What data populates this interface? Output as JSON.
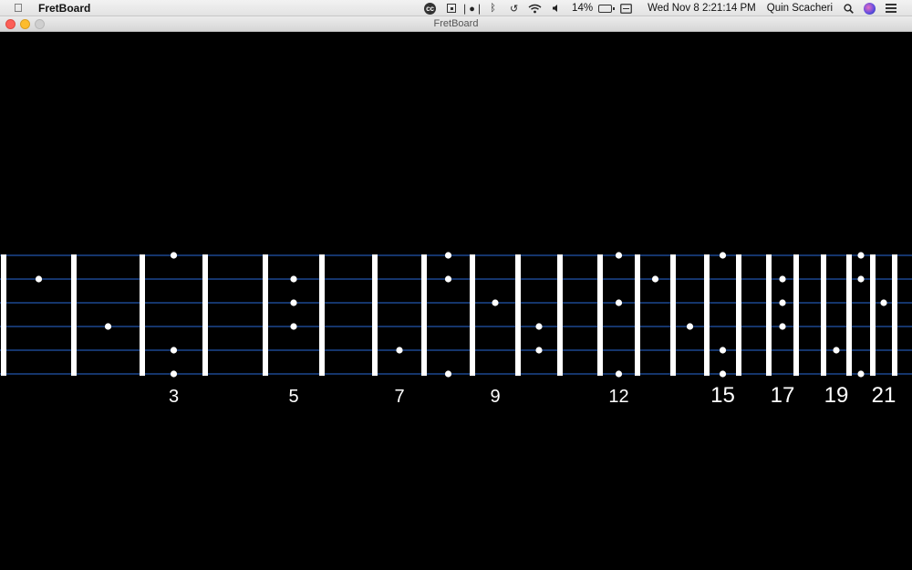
{
  "menubar": {
    "apple_icon": "apple-icon",
    "app_name": "FretBoard",
    "status_icons": [
      "creative-cloud-icon",
      "grid-icon",
      "audio-input-icon",
      "bluetooth-icon",
      "time-machine-icon",
      "wifi-icon",
      "volume-icon"
    ],
    "battery_percent": "14%",
    "datetime": "Wed Nov 8  2:21:14 PM",
    "user": "Quin Scacheri"
  },
  "window": {
    "title": "FretBoard",
    "traffic_lights": {
      "close": "#fc5f57",
      "minimize": "#fdbc2e",
      "zoom": "#cfcfcf"
    }
  },
  "fretboard": {
    "background": "#000000",
    "string_color": "#2a6ad8",
    "fret_color": "#ffffff",
    "string_count": 6,
    "fret_count": 21,
    "fret_labels": [
      "3",
      "5",
      "7",
      "9",
      "12",
      "15",
      "17",
      "19",
      "21"
    ],
    "notes": [
      {
        "fret": 1,
        "string": 2
      },
      {
        "fret": 2,
        "string": 4
      },
      {
        "fret": 3,
        "string": 1
      },
      {
        "fret": 3,
        "string": 5
      },
      {
        "fret": 3,
        "string": 6
      },
      {
        "fret": 5,
        "string": 2
      },
      {
        "fret": 5,
        "string": 3
      },
      {
        "fret": 5,
        "string": 4
      },
      {
        "fret": 7,
        "string": 5
      },
      {
        "fret": 8,
        "string": 1
      },
      {
        "fret": 8,
        "string": 2
      },
      {
        "fret": 8,
        "string": 6
      },
      {
        "fret": 9,
        "string": 3
      },
      {
        "fret": 10,
        "string": 4
      },
      {
        "fret": 10,
        "string": 5
      },
      {
        "fret": 12,
        "string": 1
      },
      {
        "fret": 12,
        "string": 3
      },
      {
        "fret": 12,
        "string": 6
      },
      {
        "fret": 13,
        "string": 2
      },
      {
        "fret": 14,
        "string": 4
      },
      {
        "fret": 15,
        "string": 1
      },
      {
        "fret": 15,
        "string": 5
      },
      {
        "fret": 15,
        "string": 6
      },
      {
        "fret": 17,
        "string": 2
      },
      {
        "fret": 17,
        "string": 3
      },
      {
        "fret": 17,
        "string": 4
      },
      {
        "fret": 19,
        "string": 5
      },
      {
        "fret": 20,
        "string": 1
      },
      {
        "fret": 20,
        "string": 2
      },
      {
        "fret": 20,
        "string": 6
      },
      {
        "fret": 21,
        "string": 3
      }
    ]
  }
}
